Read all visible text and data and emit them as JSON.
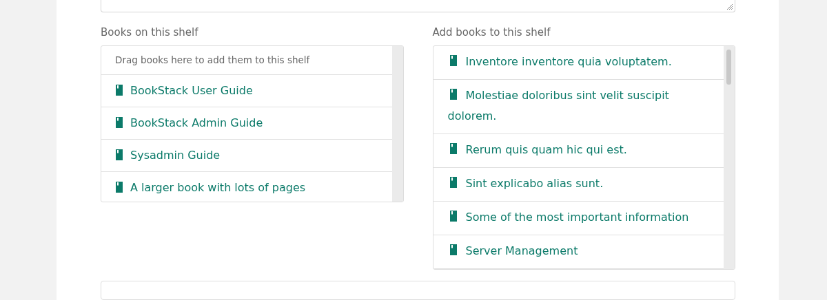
{
  "shelf_books": {
    "label": "Books on this shelf",
    "hint": "Drag books here to add them to this shelf",
    "items": [
      "BookStack User Guide",
      "BookStack Admin Guide",
      "Sysadmin Guide",
      "A larger book with lots of pages"
    ]
  },
  "available_books": {
    "label": "Add books to this shelf",
    "items": [
      "Inventore inventore quia voluptatem.",
      "Molestiae doloribus sint velit suscipit dolorem.",
      "Rerum quis quam hic qui est.",
      "Sint explicabo alias sunt.",
      "Some of the most important information",
      "Server Management"
    ]
  }
}
